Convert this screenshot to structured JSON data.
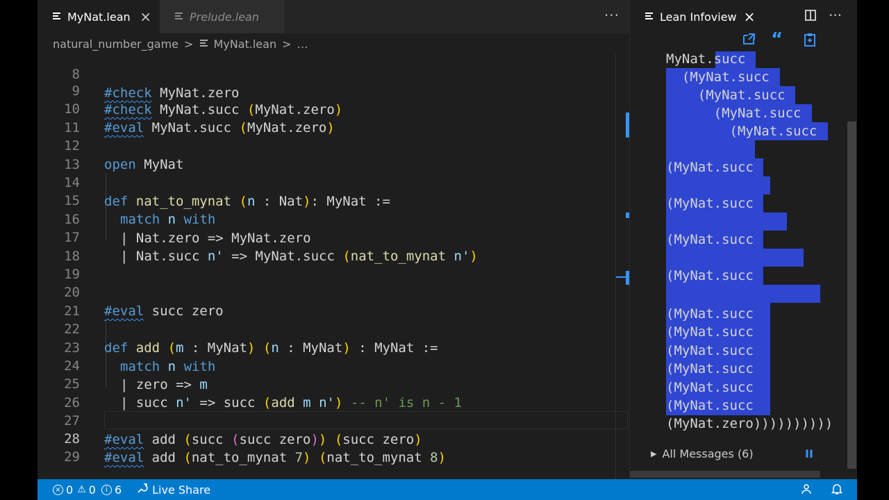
{
  "editor_tabs": [
    {
      "label": "MyNat.lean",
      "active": true,
      "close": "×"
    },
    {
      "label": "Prelude.lean",
      "active": false
    }
  ],
  "tab_more": "···",
  "breadcrumb": {
    "folder": "natural_number_game",
    "file": "MyNat.lean",
    "tail": "…",
    "sep": ">"
  },
  "code_lines": [
    {
      "n": "8"
    },
    {
      "n": "9"
    },
    {
      "n": "10"
    },
    {
      "n": "11"
    },
    {
      "n": "12"
    },
    {
      "n": "13"
    },
    {
      "n": "14"
    },
    {
      "n": "15"
    },
    {
      "n": "16"
    },
    {
      "n": "17"
    },
    {
      "n": "18"
    },
    {
      "n": "19"
    },
    {
      "n": "20"
    },
    {
      "n": "21"
    },
    {
      "n": "22"
    },
    {
      "n": "23"
    },
    {
      "n": "24"
    },
    {
      "n": "25"
    },
    {
      "n": "26"
    },
    {
      "n": "27"
    },
    {
      "n": "28"
    },
    {
      "n": "29"
    }
  ],
  "code": {
    "l8": [
      "#check",
      " MyNat.zero"
    ],
    "l9": [
      "#check",
      " MyNat.succ ",
      "(",
      "MyNat.zero",
      ")"
    ],
    "l10": [
      "#eval",
      " MyNat.succ ",
      "(",
      "MyNat.zero",
      ")"
    ],
    "l12": [
      "open",
      " MyNat"
    ],
    "l14": [
      "def",
      " ",
      "nat_to_mynat",
      " ",
      "(",
      "n",
      " : Nat",
      ")",
      ": MyNat :="
    ],
    "l15": [
      "match",
      " ",
      "n",
      " ",
      "with"
    ],
    "l16": [
      "| Nat.zero => MyNat.zero"
    ],
    "l17": [
      "| Nat.succ ",
      "n'",
      " => MyNat.succ ",
      "(",
      "nat_to_mynat",
      " ",
      "n'",
      ")"
    ],
    "l20": [
      "#eval",
      " succ zero"
    ],
    "l22": [
      "def",
      " ",
      "add",
      " ",
      "(",
      "m",
      " : MyNat",
      ")",
      " ",
      "(",
      "n",
      " : MyNat",
      ")",
      " : MyNat :="
    ],
    "l23": [
      "match",
      " ",
      "n",
      " ",
      "with"
    ],
    "l24": [
      "| zero => ",
      "m"
    ],
    "l25": [
      "| succ ",
      "n'",
      " => succ ",
      "(",
      "add",
      " ",
      "m",
      " ",
      "n'",
      ")",
      " -- n' is n - 1"
    ],
    "l27": [
      "#eval",
      " add ",
      "(",
      "succ ",
      "(",
      "succ zero",
      ")",
      ")",
      " ",
      "(",
      "succ zero",
      ")"
    ],
    "l28": [
      "#eval",
      " add ",
      "(",
      "nat_to_mynat",
      " ",
      "7",
      ")",
      " ",
      "(",
      "nat_to_mynat",
      " ",
      "8",
      ")"
    ]
  },
  "infoview": {
    "title": "Lean Infoview",
    "close": "×",
    "more": "···",
    "tool_icons": [
      "goto-icon",
      "quote-icon",
      "clipboard-icon"
    ],
    "quote_glyph": "“",
    "goal_lines": [
      "MyNat.succ",
      "  (MyNat.succ",
      "    (MyNat.succ",
      "      (MyNat.succ",
      "        (MyNat.succ",
      "",
      "(MyNat.succ",
      "",
      "(MyNat.succ",
      "",
      "(MyNat.succ",
      "",
      "(MyNat.succ",
      "",
      "(MyNat.succ",
      "(MyNat.succ",
      "(MyNat.succ",
      "(MyNat.succ",
      "(MyNat.succ",
      "(MyNat.succ",
      "(MyNat.zero))))))))))"
    ],
    "all_messages": "All Messages (6)",
    "pause": "II"
  },
  "status": {
    "errors": "0",
    "warnings": "0",
    "infos": "6",
    "live_share": "Live Share"
  },
  "colors": {
    "accent": "#007acc",
    "selection": "#2f46d0",
    "keyword": "#569cd6",
    "function": "#dcdcaa"
  }
}
